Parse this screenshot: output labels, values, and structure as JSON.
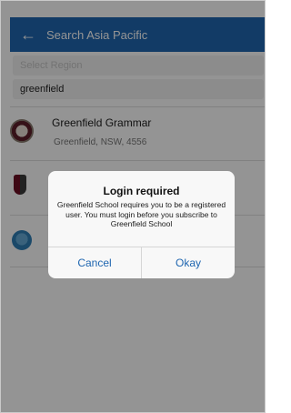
{
  "header": {
    "back_icon": "arrow-left-icon",
    "title": "Search Asia Pacific",
    "color": "#1f66b0"
  },
  "filters": {
    "region_placeholder": "Select Region",
    "search_value": "greenfield"
  },
  "results": [
    {
      "name": "Greenfield Grammar",
      "location": "Greenfield, NSW, 4556"
    }
  ],
  "dialog": {
    "title": "Login required",
    "message": "Greenfield School requires you to be a registered user. You must login before you subscribe to Greenfield School",
    "cancel_label": "Cancel",
    "okay_label": "Okay",
    "button_color": "#1f66b0"
  }
}
